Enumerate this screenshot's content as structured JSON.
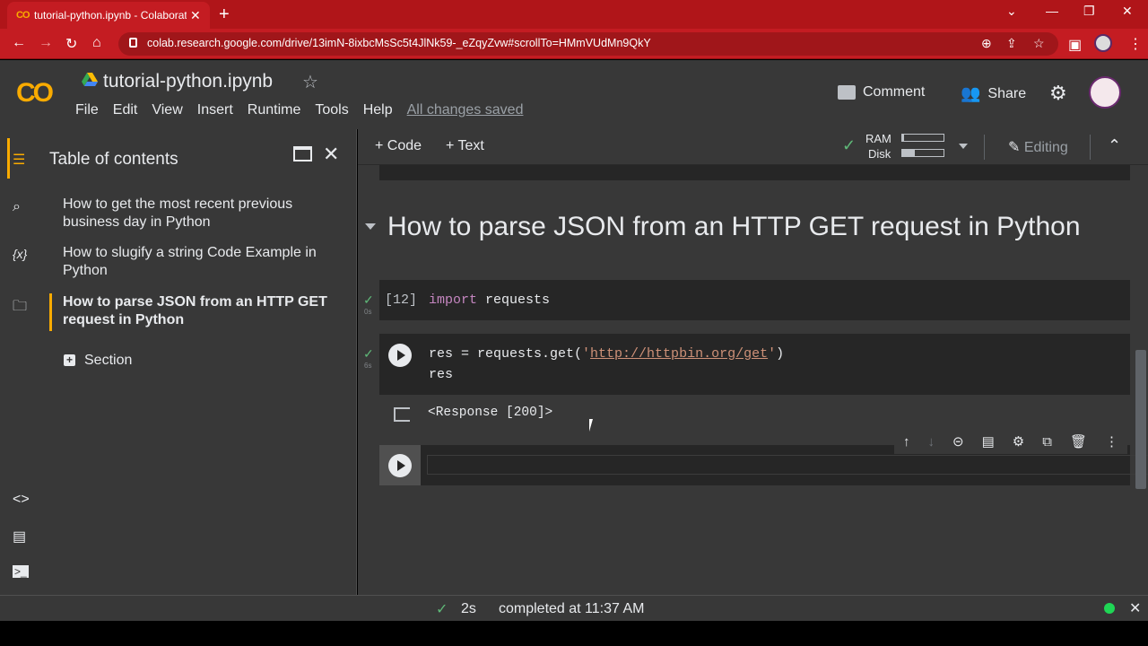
{
  "browser": {
    "tab_title": "tutorial-python.ipynb - Colaborat",
    "tab_logo": "CO",
    "url": "colab.research.google.com/drive/13imN-8ixbcMsSc5t4JlNk59-_eZqyZvw#scrollTo=HMmVUdMn9QkY"
  },
  "header": {
    "logo": "CO",
    "title": "tutorial-python.ipynb",
    "menu": [
      "File",
      "Edit",
      "View",
      "Insert",
      "Runtime",
      "Tools",
      "Help"
    ],
    "saved_status": "All changes saved",
    "comment_label": "Comment",
    "share_label": "Share"
  },
  "sidebar": {
    "title": "Table of contents",
    "items": [
      {
        "label": "How to get the most recent previous business day in Python"
      },
      {
        "label": "How to slugify a string Code Example in Python"
      },
      {
        "label": "How to parse JSON from an HTTP GET request in Python"
      }
    ],
    "section_label": "Section",
    "variables_icon_label": "{x}"
  },
  "toolbar": {
    "code_label": "+ Code",
    "text_label": "+ Text",
    "ram_label": "RAM",
    "disk_label": "Disk",
    "ram_usage": 0.05,
    "disk_usage": 0.3,
    "editing_label": "Editing"
  },
  "notebook": {
    "section_heading": "How to parse JSON from an HTTP GET request in Python",
    "cell1": {
      "exec_count": "[12]",
      "keyword": "import",
      "rest": " requests",
      "time": "0s"
    },
    "cell2": {
      "line1_pre": "res = requests.get(",
      "line1_q1": "'",
      "line1_url": "http://httpbin.org/get",
      "line1_q2": "'",
      "line1_post": ")",
      "line2": "res",
      "time": "6s",
      "output": "<Response [200]>"
    }
  },
  "status": {
    "duration": "2s",
    "message": "completed at 11:37 AM"
  },
  "colors": {
    "accent": "#f9ab00",
    "chrome_red": "#b01519",
    "ok_green": "#5fb878",
    "conn_green": "#1fd655"
  }
}
